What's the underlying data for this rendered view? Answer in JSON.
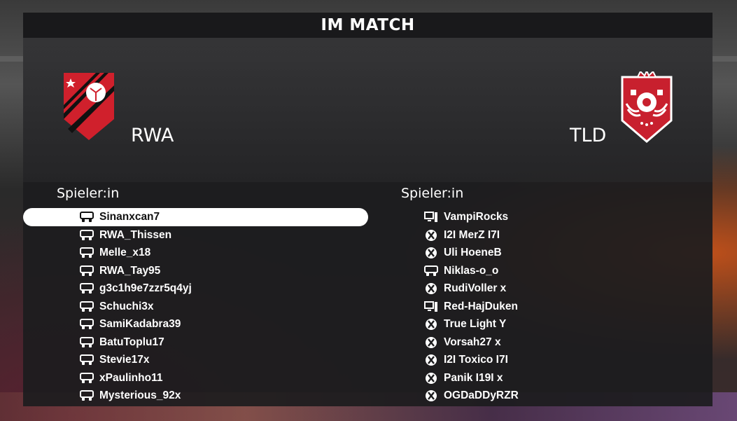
{
  "title": "IM MATCH",
  "home": {
    "name": "RWA",
    "players_header": "Spieler:in",
    "players": [
      {
        "name": "Sinanxcan7",
        "platform": "playstation-icon"
      },
      {
        "name": "RWA_Thissen",
        "platform": "playstation-icon"
      },
      {
        "name": "Melle_x18",
        "platform": "playstation-icon"
      },
      {
        "name": "RWA_Tay95",
        "platform": "playstation-icon"
      },
      {
        "name": "g3c1h9e7zzr5q4yj",
        "platform": "playstation-icon"
      },
      {
        "name": "Schuchi3x",
        "platform": "playstation-icon"
      },
      {
        "name": "SamiKadabra39",
        "platform": "playstation-icon"
      },
      {
        "name": "BatuToplu17",
        "platform": "playstation-icon"
      },
      {
        "name": "Stevie17x",
        "platform": "playstation-icon"
      },
      {
        "name": "xPaulinho11",
        "platform": "playstation-icon"
      },
      {
        "name": "Mysterious_92x",
        "platform": "playstation-icon"
      }
    ]
  },
  "away": {
    "name": "TLD",
    "players_header": "Spieler:in",
    "players": [
      {
        "name": "VampiRocks",
        "platform": "pc-icon"
      },
      {
        "name": "I2I MerZ I7I",
        "platform": "xbox-icon"
      },
      {
        "name": "Uli HoeneB",
        "platform": "xbox-icon"
      },
      {
        "name": "Niklas-o_o",
        "platform": "playstation-icon"
      },
      {
        "name": "RudiVoller x",
        "platform": "xbox-icon"
      },
      {
        "name": "Red-HajDuken",
        "platform": "pc-icon"
      },
      {
        "name": "True Light Y",
        "platform": "xbox-icon"
      },
      {
        "name": "Vorsah27 x",
        "platform": "xbox-icon"
      },
      {
        "name": "I2I Toxico I7I",
        "platform": "xbox-icon"
      },
      {
        "name": "Panik I19I x",
        "platform": "xbox-icon"
      },
      {
        "name": "OGDaDDyRZR",
        "platform": "xbox-icon"
      }
    ]
  },
  "colors": {
    "home_crest": "#d0202c",
    "away_crest": "#c8202e",
    "highlight": "#ffffff"
  }
}
